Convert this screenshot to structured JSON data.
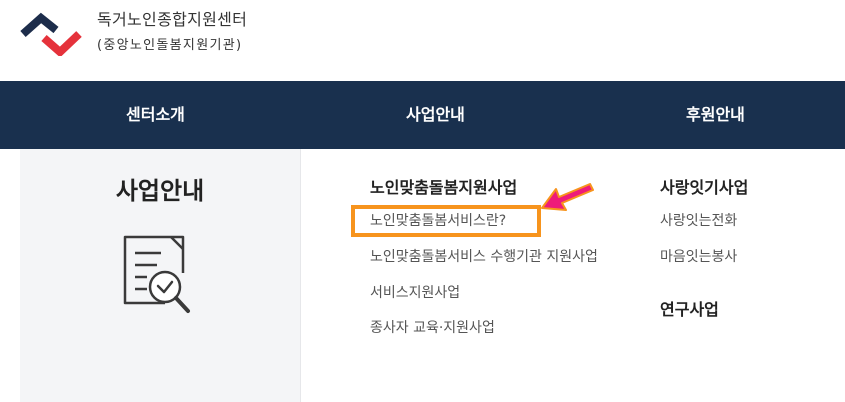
{
  "header": {
    "org_title": "독거노인종합지원센터",
    "org_subtitle": "(중앙노인돌봄지원기관)"
  },
  "nav": [
    {
      "label": "센터소개"
    },
    {
      "label": "사업안내"
    },
    {
      "label": "후원안내"
    }
  ],
  "dropdown": {
    "side_title": "사업안내",
    "col1": {
      "heading": "노인맞춤돌봄지원사업",
      "items": [
        "노인맞춤돌봄서비스란?",
        "노인맞춤돌봄서비스 수행기관 지원사업",
        "서비스지원사업",
        "종사자 교육·지원사업"
      ]
    },
    "col2": {
      "heading": "사랑잇기사업",
      "items": [
        "사랑잇는전화",
        "마음잇는봉사"
      ]
    },
    "col3": {
      "heading": "연구사업"
    }
  },
  "icons": {
    "logo": "logo-mark-icon",
    "side": "document-magnifier-icon",
    "pointer": "pointer-arrow-icon"
  },
  "colors": {
    "nav_bg": "#19304e",
    "logo_navy": "#1d2d4b",
    "logo_red": "#e5323b",
    "highlight": "#f7941d",
    "arrow": "#ee1b7a"
  }
}
